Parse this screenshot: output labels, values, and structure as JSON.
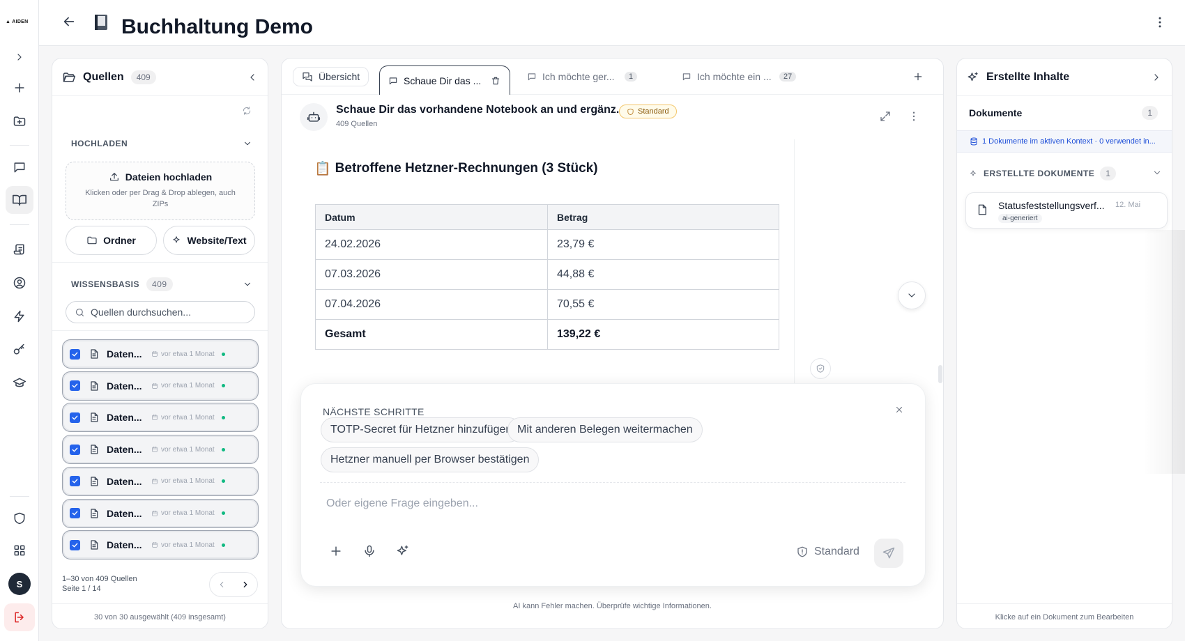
{
  "app": {
    "logo_text": "AIDEN",
    "title": "Buchhaltung Demo",
    "user_initial": "S"
  },
  "sources": {
    "title": "Quellen",
    "count": "409",
    "upload_section": "HOCHLADEN",
    "upload_title": "Dateien hochladen",
    "upload_hint": "Klicken oder per Drag & Drop ablegen, auch ZIPs",
    "folder_button": "Ordner",
    "website_button": "Website/Text",
    "kb_section": "WISSENSBASIS",
    "kb_count": "409",
    "search_placeholder": "Quellen durchsuchen...",
    "items": [
      {
        "name": "Daten...",
        "time": "vor etwa 1 Monat"
      },
      {
        "name": "Daten...",
        "time": "vor etwa 1 Monat"
      },
      {
        "name": "Daten...",
        "time": "vor etwa 1 Monat"
      },
      {
        "name": "Daten...",
        "time": "vor etwa 1 Monat"
      },
      {
        "name": "Daten...",
        "time": "vor etwa 1 Monat"
      },
      {
        "name": "Daten...",
        "time": "vor etwa 1 Monat"
      },
      {
        "name": "Daten...",
        "time": "vor etwa 1 Monat"
      }
    ],
    "range": "1–30 von 409 Quellen",
    "page": "Seite 1 / 14",
    "selection": "30 von 30 ausgewählt (409 insgesamt)"
  },
  "tabs": [
    {
      "label": "Übersicht"
    },
    {
      "label": "Schaue Dir das ..."
    },
    {
      "label": "Ich möchte ger...",
      "count": "1"
    },
    {
      "label": "Ich möchte ein ...",
      "count": "27"
    }
  ],
  "chat": {
    "title": "Schaue Dir das vorhandene Notebook an und ergänz...",
    "mode_badge": "Standard",
    "sources_count": "409 Quellen",
    "heading_emoji": "📋",
    "heading": "Betroffene Hetzner-Rechnungen (3 Stück)",
    "table": {
      "headers": [
        "Datum",
        "Betrag"
      ],
      "rows": [
        [
          "24.02.2026",
          "23,79 €"
        ],
        [
          "07.03.2026",
          "44,88 €"
        ],
        [
          "07.04.2026",
          "70,55 €"
        ]
      ],
      "total": [
        "Gesamt",
        "139,22 €"
      ]
    },
    "next_steps_label": "NÄCHSTE SCHRITTE",
    "suggestions": [
      "TOTP-Secret für Hetzner hinzufügen",
      "Mit anderen Belegen weitermachen",
      "Hetzner manuell per Browser bestätigen"
    ],
    "input_placeholder": "Oder eigene Frage eingeben...",
    "mode": "Standard",
    "disclaimer": "AI kann Fehler machen. Überprüfe wichtige Informationen."
  },
  "created": {
    "title": "Erstellte Inhalte",
    "documents_label": "Dokumente",
    "documents_count": "1",
    "context_info": "1 Dokumente im aktiven Kontext · 0 verwendet in...",
    "section": "ERSTELLTE DOKUMENTE",
    "section_count": "1",
    "doc": {
      "name": "Statusfeststellungsverf...",
      "date": "12. Mai",
      "tag": "ai-generiert"
    },
    "footer": "Klicke auf ein Dokument zum Bearbeiten"
  }
}
